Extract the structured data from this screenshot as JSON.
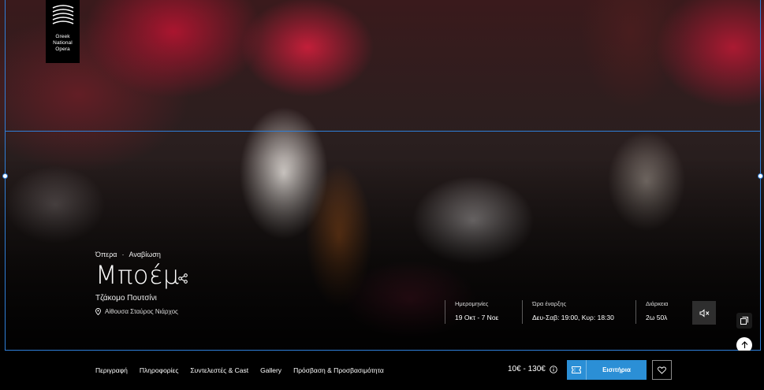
{
  "brand": {
    "logo_lines": [
      "Greek",
      "National",
      "Opera"
    ]
  },
  "production": {
    "category": "Όπερα",
    "separator": "·",
    "tag": "Αναβίωση",
    "title": "Μποέμ",
    "composer": "Τζάκομο Πουτσίνι",
    "venue": "Αίθουσα Σταύρος Νιάρχος"
  },
  "info": {
    "dates_label": "Ημερομηνίες",
    "dates_value": "19 Οκτ - 7 Νοε",
    "time_label": "Ώρα έναρξης",
    "time_value": "Δευ-Σαβ: 19:00, Κυρ: 18:30",
    "duration_label": "Διάρκεια",
    "duration_value": "2ω 50λ"
  },
  "nav": {
    "tabs": [
      {
        "label": "Περιγραφή"
      },
      {
        "label": "Πληροφορίες"
      },
      {
        "label": "Συντελεστές & Cast"
      },
      {
        "label": "Gallery"
      },
      {
        "label": "Πρόσβαση & Προσβασιμότητα"
      }
    ]
  },
  "purchase": {
    "price": "10€ - 130€",
    "ticket_label": "Εισιτήρια"
  },
  "icons": [
    "share-icon",
    "pin-icon",
    "mute-icon",
    "copy-icon",
    "arrow-up-icon",
    "info-icon",
    "ticket-icon",
    "heart-icon"
  ],
  "colors": {
    "accent": "#2b8fd6",
    "bar": "#000000"
  }
}
